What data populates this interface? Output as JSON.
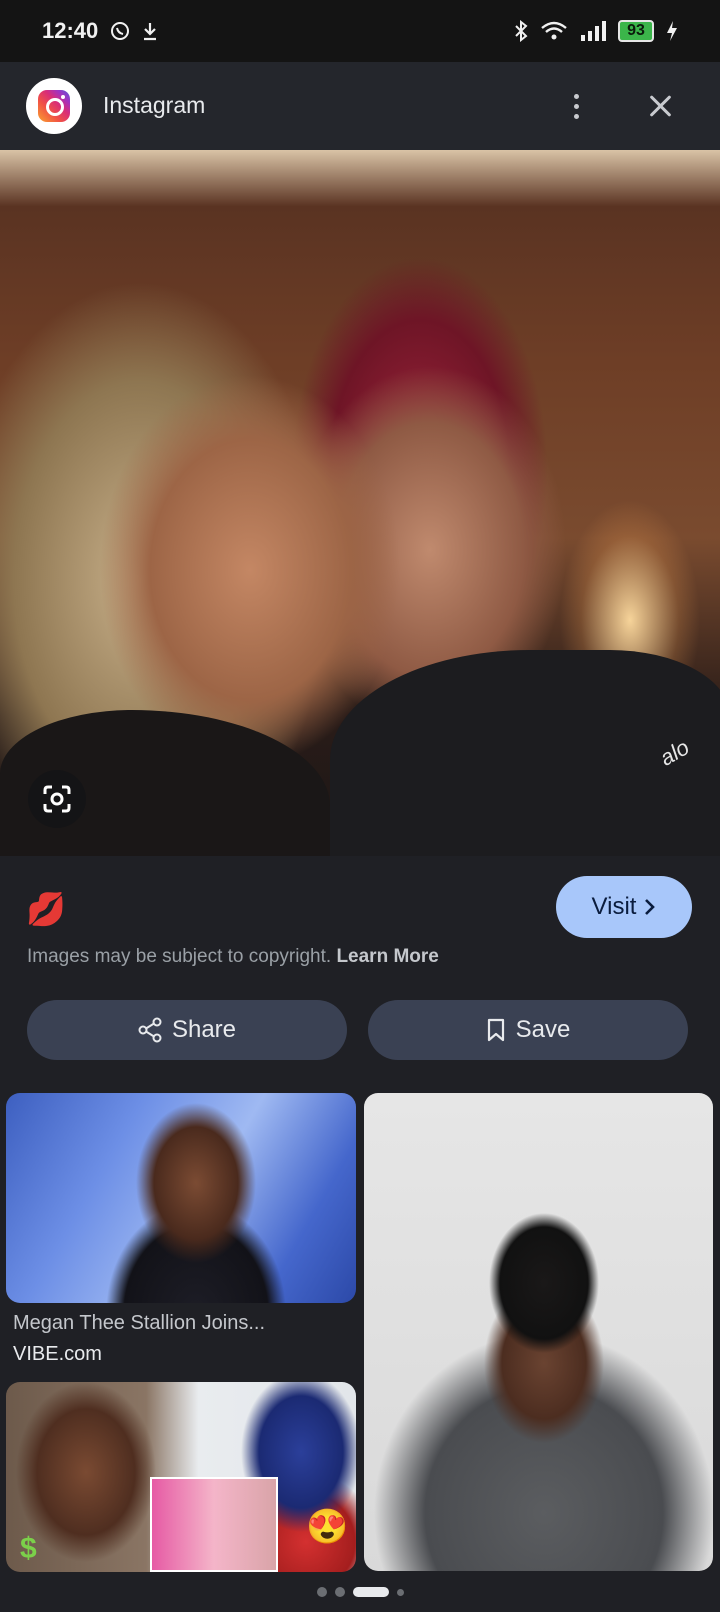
{
  "status_bar": {
    "time": "12:40",
    "battery": "93",
    "icons": [
      "whatsapp-icon",
      "download-icon",
      "bluetooth-icon",
      "wifi-icon",
      "signal-icon",
      "charging-icon"
    ]
  },
  "header": {
    "app_icon": "instagram-icon",
    "title": "Instagram"
  },
  "main_image": {
    "watermark": "alo"
  },
  "info": {
    "emoji": "💋",
    "visit_label": "Visit",
    "copyright_text": "Images may be subject to copyright.",
    "learn_more": "Learn More",
    "share_label": "Share",
    "save_label": "Save"
  },
  "results": [
    {
      "title": "Megan Thee Stallion Joins...",
      "source": "VIBE.com"
    }
  ],
  "colors": {
    "background": "#1f2025",
    "visit_button": "#a8c7fa",
    "action_button": "#3a4153"
  }
}
